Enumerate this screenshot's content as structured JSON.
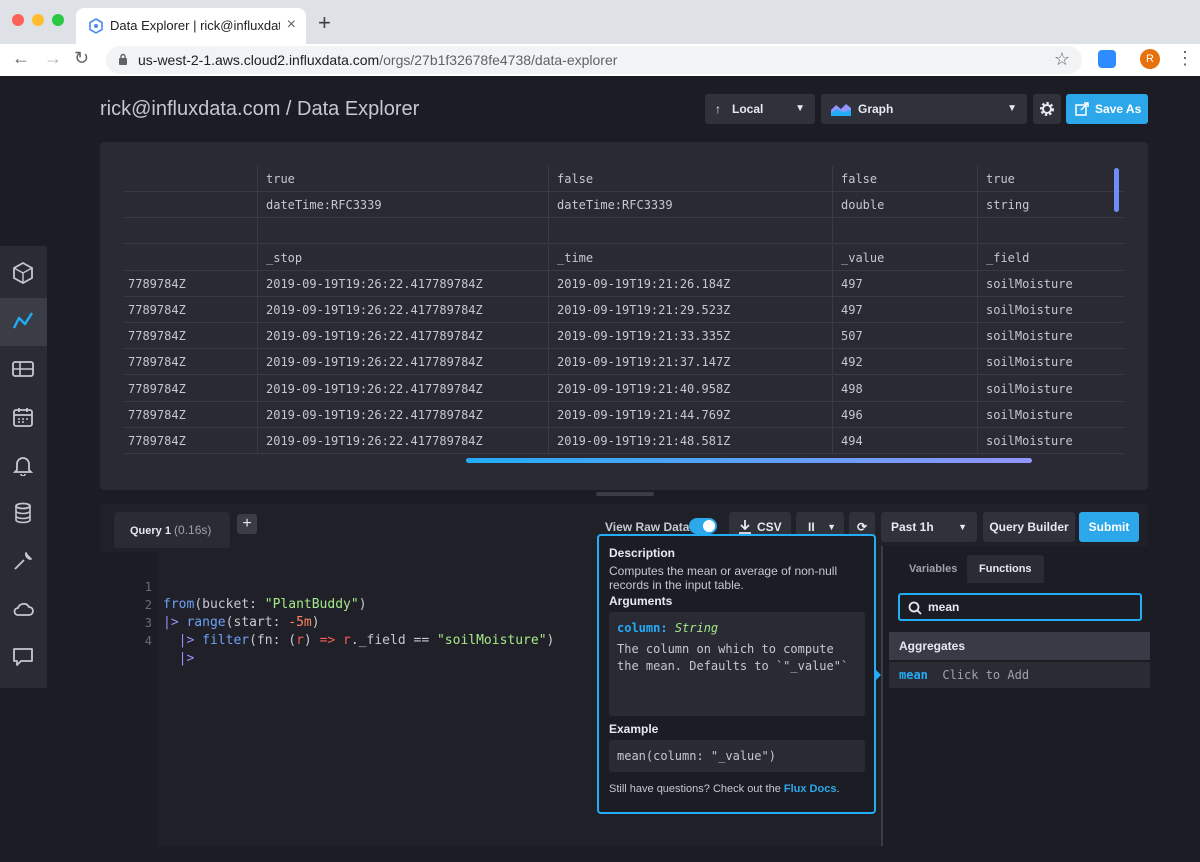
{
  "browser": {
    "tab_title": "Data Explorer | rick@influxdata.com",
    "tab_close": "×",
    "new_tab": "+",
    "url_host": "us-west-2-1.aws.cloud2.influxdata.com",
    "url_path": "/orgs/27b1f32678fe4738/data-explorer",
    "avatar_letter": "R"
  },
  "header": {
    "title": "rick@influxdata.com / Data Explorer",
    "local_label": "Local",
    "graph_label": "Graph",
    "save_as_label": "Save As"
  },
  "sidebar": {
    "items": [
      "logo-icon",
      "data-explorer-icon",
      "dashboards-icon",
      "tasks-icon",
      "alerts-icon",
      "buckets-icon",
      "settings-icon",
      "cloud-icon",
      "feedback-icon"
    ]
  },
  "table": {
    "rows": [
      [
        "",
        "true",
        "false",
        "false",
        "true"
      ],
      [
        "",
        "dateTime:RFC3339",
        "dateTime:RFC3339",
        "double",
        "string"
      ],
      [
        "",
        "",
        "",
        "",
        ""
      ],
      [
        "",
        "_stop",
        "_time",
        "_value",
        "_field"
      ],
      [
        "7789784Z",
        "2019-09-19T19:26:22.417789784Z",
        "2019-09-19T19:21:26.184Z",
        "497",
        "soilMoisture"
      ],
      [
        "7789784Z",
        "2019-09-19T19:26:22.417789784Z",
        "2019-09-19T19:21:29.523Z",
        "497",
        "soilMoisture"
      ],
      [
        "7789784Z",
        "2019-09-19T19:26:22.417789784Z",
        "2019-09-19T19:21:33.335Z",
        "507",
        "soilMoisture"
      ],
      [
        "7789784Z",
        "2019-09-19T19:26:22.417789784Z",
        "2019-09-19T19:21:37.147Z",
        "492",
        "soilMoisture"
      ],
      [
        "7789784Z",
        "2019-09-19T19:26:22.417789784Z",
        "2019-09-19T19:21:40.958Z",
        "498",
        "soilMoisture"
      ],
      [
        "7789784Z",
        "2019-09-19T19:26:22.417789784Z",
        "2019-09-19T19:21:44.769Z",
        "496",
        "soilMoisture"
      ],
      [
        "7789784Z",
        "2019-09-19T19:26:22.417789784Z",
        "2019-09-19T19:21:48.581Z",
        "494",
        "soilMoisture"
      ]
    ]
  },
  "query": {
    "tab_label": "Query 1",
    "tab_duration": "(0.16s)",
    "add_label": "+",
    "view_raw_label": "View Raw Data",
    "view_raw_on": true,
    "csv_label": "CSV",
    "pause_label": "II",
    "past_label": "Past 1h",
    "query_builder_label": "Query Builder",
    "submit_label": "Submit",
    "line_numbers": [
      "1",
      "2",
      "3",
      "4"
    ]
  },
  "tooltip": {
    "description_heading": "Description",
    "description_text": "Computes the mean or average of non-null records in the input table.",
    "arguments_heading": "Arguments",
    "arg_name": "column:",
    "arg_type": "String",
    "arg_desc": "The column on which to compute the mean. Defaults to `\"_value\"`",
    "example_heading": "Example",
    "example_code": "mean(column: \"_value\")",
    "footer_text": "Still have questions? Check out the ",
    "footer_link": "Flux Docs",
    "footer_end": "."
  },
  "functions": {
    "tab_variables": "Variables",
    "tab_functions": "Functions",
    "search_value": "mean",
    "category": "Aggregates",
    "item_name": "mean",
    "item_hint": "Click to Add"
  },
  "colors": {
    "accent": "#2ba7ea",
    "tooltip_border": "#22adf6",
    "background": "#1c1d24"
  }
}
